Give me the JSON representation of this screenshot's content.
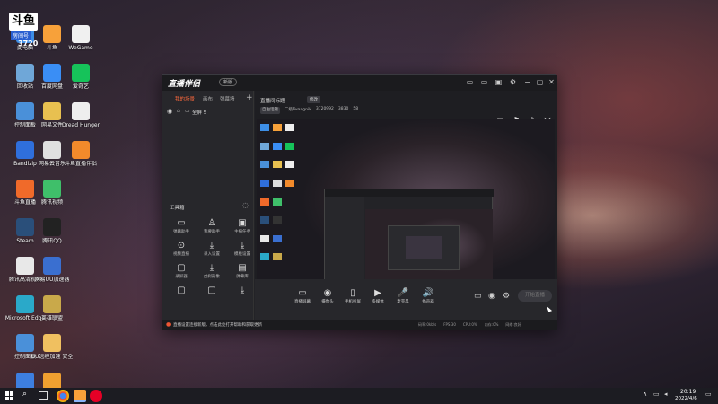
{
  "desktop": {
    "icons": [
      {
        "label": "此电脑",
        "color": "#3d8ee6"
      },
      {
        "label": "斗鱼",
        "color": "#f7a13a"
      },
      {
        "label": "WeGame",
        "color": "#f0f0f0"
      },
      {
        "label": "回收站",
        "color": "#6fa7d8"
      },
      {
        "label": "百度网盘",
        "color": "#3a8ef5"
      },
      {
        "label": "爱奇艺",
        "color": "#16c35a"
      },
      {
        "label": "控制面板",
        "color": "#4a90d9"
      },
      {
        "label": "网易文件",
        "color": "#e8c050"
      },
      {
        "label": "Dread Hunger",
        "color": "#eeeeee"
      },
      {
        "label": "Bandizip",
        "color": "#2f6fdc"
      },
      {
        "label": "网易云音乐",
        "color": "#e0e0e0"
      },
      {
        "label": "斗鱼直播伴侣",
        "color": "#f28a2b"
      },
      {
        "label": "斗鱼直播",
        "color": "#f06a2a"
      },
      {
        "label": "腾讯视频",
        "color": "#3fbf6a"
      },
      {
        "label": "",
        "color": "transparent"
      },
      {
        "label": "Steam",
        "color": "#2a4f7a"
      },
      {
        "label": "腾讯QQ",
        "color": "#222"
      },
      {
        "label": "",
        "color": "transparent"
      },
      {
        "label": "腾讯高清视频",
        "color": "#e8e8e8"
      },
      {
        "label": "网易UU加速器",
        "color": "#3a6fd0"
      },
      {
        "label": "",
        "color": "transparent"
      },
      {
        "label": "Microsoft Edge",
        "color": "#2aa9c9"
      },
      {
        "label": "英雄联盟",
        "color": "#c9a94a"
      },
      {
        "label": "",
        "color": "transparent"
      },
      {
        "label": "控制面板",
        "color": "#4a90d9"
      },
      {
        "label": "UU远程加速 安全",
        "color": "#f0c060"
      },
      {
        "label": "",
        "color": "transparent"
      },
      {
        "label": "桌面设置",
        "color": "#3d7fe0"
      },
      {
        "label": "火绒安全软件",
        "color": "#f0a030"
      }
    ],
    "overlay_badge": "房间号",
    "overlay_number": "3720"
  },
  "app": {
    "name": "直播伴侣",
    "version": "新版",
    "sidebar_tabs": [
      "我的场景",
      "画布",
      "弹幕墙"
    ],
    "scene_label": "全屏 5",
    "tools_title": "工具箱",
    "tools": [
      {
        "label": "弹幕助手",
        "icon": "▭"
      },
      {
        "label": "我要助手",
        "icon": "♙"
      },
      {
        "label": "主播任务",
        "icon": "▣"
      },
      {
        "label": "视频直播",
        "icon": "⊙"
      },
      {
        "label": "录入设置",
        "icon": "⤓"
      },
      {
        "label": "模板设置",
        "icon": "⤓"
      },
      {
        "label": "录屏器",
        "icon": "▢"
      },
      {
        "label": "虚拟形象",
        "icon": "⤓"
      },
      {
        "label": "弹幕库",
        "icon": "▤"
      },
      {
        "label": "",
        "icon": "▢"
      },
      {
        "label": "",
        "icon": "▢"
      },
      {
        "label": "",
        "icon": "⤓"
      }
    ],
    "room_title": "直播间标题",
    "room_badge": "修改",
    "room_tags": [
      "自由话题",
      "二级Twangnik",
      "3720992",
      "3830",
      "58"
    ],
    "bottom_buttons": [
      {
        "label": "直播屏幕",
        "icon": "▭"
      },
      {
        "label": "摄像头",
        "icon": "◉"
      },
      {
        "label": "手机投屏",
        "icon": "▯"
      },
      {
        "label": "多媒体",
        "icon": "▶"
      },
      {
        "label": "麦克风",
        "icon": "🎤"
      },
      {
        "label": "扬声器",
        "icon": "🔊"
      }
    ],
    "start_button": "开始直播",
    "notice": "直播设置连接新版，点击此处打开帮助和获取更新",
    "status_items": [
      "码率:0kb/s",
      "FPS:30",
      "CPU:0%",
      "内存:0%",
      "网络:良好"
    ]
  },
  "taskbar": {
    "time": "20:19",
    "date": "2022/4/6"
  }
}
